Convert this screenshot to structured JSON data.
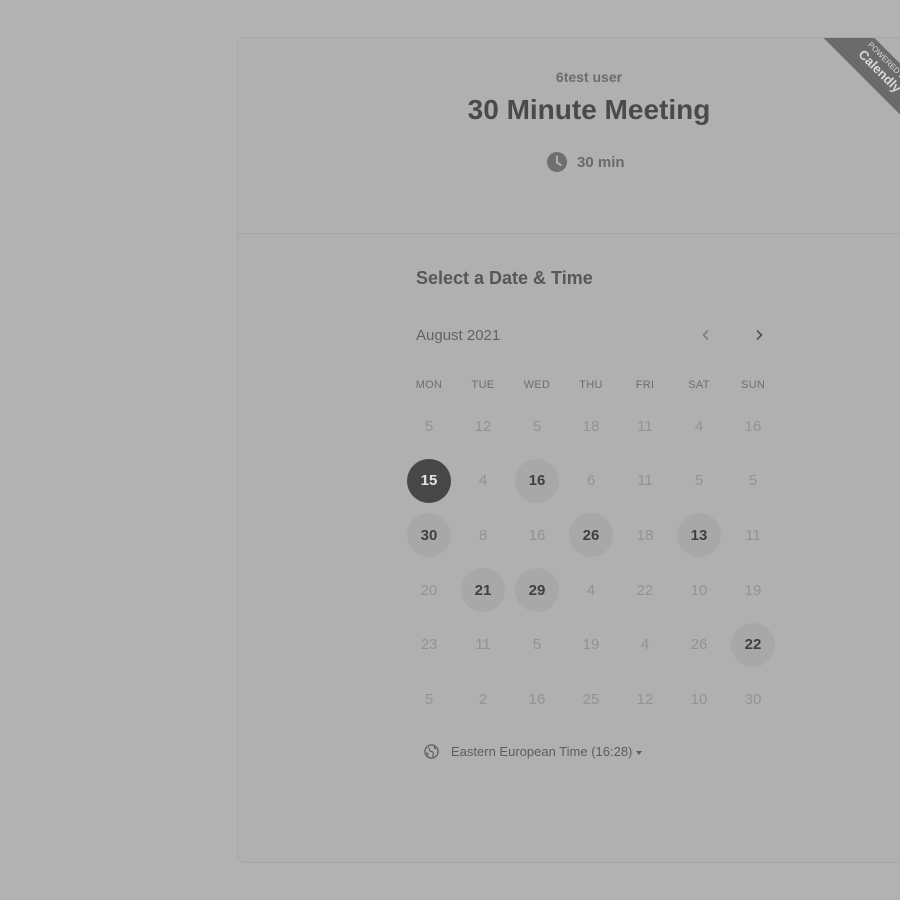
{
  "event": {
    "host": "6test user",
    "title": "30 Minute Meeting",
    "duration": "30 min",
    "duration_icon": "clock-icon"
  },
  "badge": {
    "small_text": "POWERED BY",
    "big_text": "Calendly"
  },
  "calendar": {
    "section_title": "Select a Date & Time",
    "month_label": "August 2021",
    "prev_icon": "chevron-left-icon",
    "next_icon": "chevron-right-icon",
    "weekdays": [
      "MON",
      "TUE",
      "WED",
      "THU",
      "FRI",
      "SAT",
      "SUN"
    ],
    "weeks": [
      [
        {
          "label": "5",
          "state": "disabled"
        },
        {
          "label": "12",
          "state": "disabled"
        },
        {
          "label": "5",
          "state": "disabled"
        },
        {
          "label": "18",
          "state": "disabled"
        },
        {
          "label": "11",
          "state": "disabled"
        },
        {
          "label": "4",
          "state": "disabled"
        },
        {
          "label": "16",
          "state": "disabled"
        }
      ],
      [
        {
          "label": "15",
          "state": "selected"
        },
        {
          "label": "4",
          "state": "disabled"
        },
        {
          "label": "16",
          "state": "available"
        },
        {
          "label": "6",
          "state": "disabled"
        },
        {
          "label": "11",
          "state": "disabled"
        },
        {
          "label": "5",
          "state": "disabled"
        },
        {
          "label": "5",
          "state": "disabled"
        }
      ],
      [
        {
          "label": "30",
          "state": "available"
        },
        {
          "label": "8",
          "state": "disabled"
        },
        {
          "label": "16",
          "state": "disabled"
        },
        {
          "label": "26",
          "state": "available"
        },
        {
          "label": "18",
          "state": "disabled"
        },
        {
          "label": "13",
          "state": "available"
        },
        {
          "label": "11",
          "state": "disabled"
        }
      ],
      [
        {
          "label": "20",
          "state": "disabled"
        },
        {
          "label": "21",
          "state": "available"
        },
        {
          "label": "29",
          "state": "available"
        },
        {
          "label": "4",
          "state": "disabled"
        },
        {
          "label": "22",
          "state": "disabled"
        },
        {
          "label": "10",
          "state": "disabled"
        },
        {
          "label": "19",
          "state": "disabled"
        }
      ],
      [
        {
          "label": "23",
          "state": "disabled"
        },
        {
          "label": "11",
          "state": "disabled"
        },
        {
          "label": "5",
          "state": "disabled"
        },
        {
          "label": "19",
          "state": "disabled"
        },
        {
          "label": "4",
          "state": "disabled"
        },
        {
          "label": "26",
          "state": "disabled"
        },
        {
          "label": "22",
          "state": "available"
        }
      ],
      [
        {
          "label": "5",
          "state": "disabled"
        },
        {
          "label": "2",
          "state": "disabled"
        },
        {
          "label": "16",
          "state": "disabled"
        },
        {
          "label": "25",
          "state": "disabled"
        },
        {
          "label": "12",
          "state": "disabled"
        },
        {
          "label": "10",
          "state": "disabled"
        },
        {
          "label": "30",
          "state": "disabled"
        }
      ]
    ]
  },
  "timezone": {
    "label": "Eastern European Time (16:28)",
    "icon": "globe-icon"
  },
  "colors": {
    "background": "#b2b2b2",
    "selected_day": "#474747",
    "available_day": "#a8a8a8"
  }
}
